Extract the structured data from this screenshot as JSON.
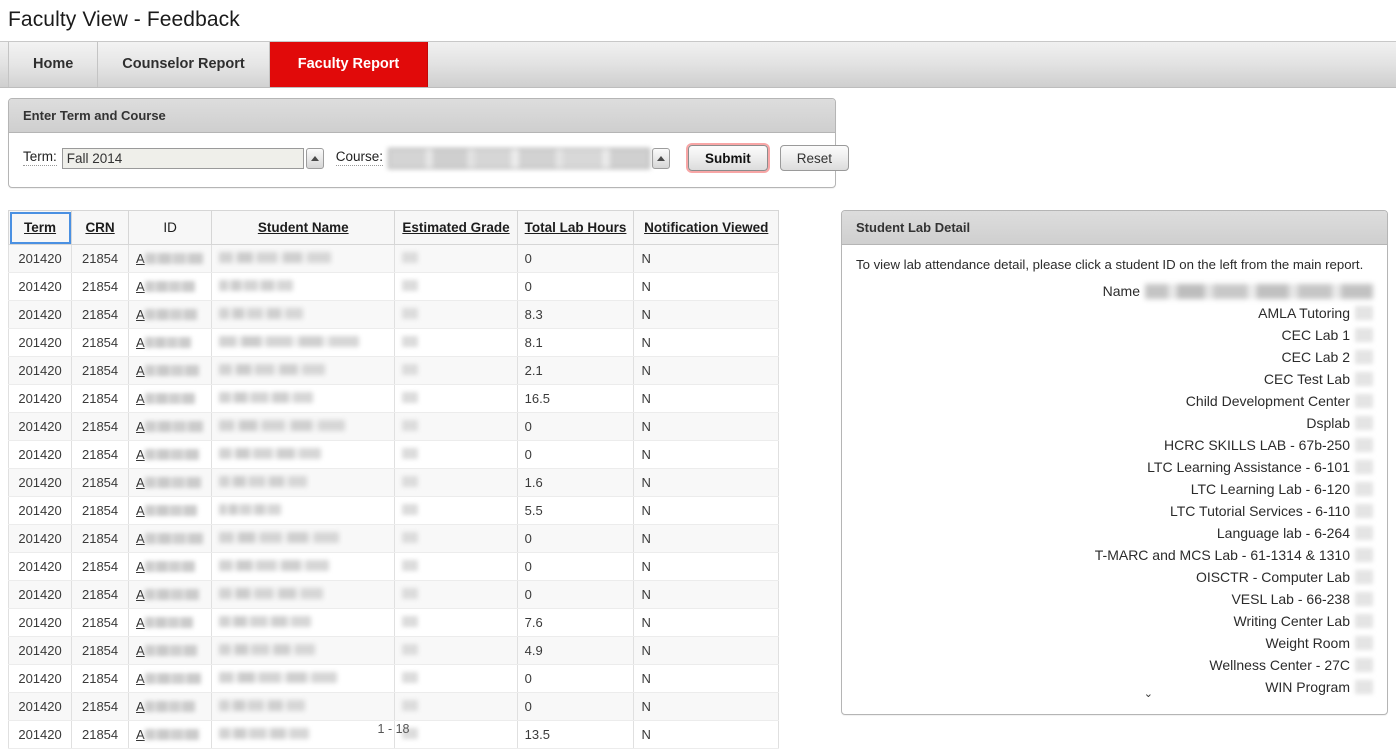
{
  "page": {
    "title": "Faculty View - Feedback"
  },
  "tabs": [
    {
      "label": "Home",
      "active": false
    },
    {
      "label": "Counselor Report",
      "active": false
    },
    {
      "label": "Faculty Report",
      "active": true
    }
  ],
  "form": {
    "legend": "Enter Term and Course",
    "term_label": "Term:",
    "term_value": "Fall 2014",
    "course_label": "Course:",
    "course_value": "",
    "submit_label": "Submit",
    "reset_label": "Reset"
  },
  "table": {
    "columns": [
      {
        "label": "Term",
        "sortable": true,
        "focused": true
      },
      {
        "label": "CRN",
        "sortable": true,
        "focused": false
      },
      {
        "label": "ID",
        "sortable": false,
        "focused": false
      },
      {
        "label": "Student Name",
        "sortable": true,
        "focused": false
      },
      {
        "label": "Estimated Grade",
        "sortable": true,
        "focused": false
      },
      {
        "label": "Total Lab Hours",
        "sortable": true,
        "focused": false
      },
      {
        "label": "Notification Viewed",
        "sortable": true,
        "focused": false
      }
    ],
    "rows": [
      {
        "term": "201420",
        "crn": "21854",
        "id_prefix": "A",
        "hours": "0",
        "notification": "N"
      },
      {
        "term": "201420",
        "crn": "21854",
        "id_prefix": "A",
        "hours": "0",
        "notification": "N"
      },
      {
        "term": "201420",
        "crn": "21854",
        "id_prefix": "A",
        "hours": "8.3",
        "notification": "N"
      },
      {
        "term": "201420",
        "crn": "21854",
        "id_prefix": "A",
        "hours": "8.1",
        "notification": "N"
      },
      {
        "term": "201420",
        "crn": "21854",
        "id_prefix": "A",
        "hours": "2.1",
        "notification": "N"
      },
      {
        "term": "201420",
        "crn": "21854",
        "id_prefix": "A",
        "hours": "16.5",
        "notification": "N"
      },
      {
        "term": "201420",
        "crn": "21854",
        "id_prefix": "A",
        "hours": "0",
        "notification": "N"
      },
      {
        "term": "201420",
        "crn": "21854",
        "id_prefix": "A",
        "hours": "0",
        "notification": "N"
      },
      {
        "term": "201420",
        "crn": "21854",
        "id_prefix": "A",
        "hours": "1.6",
        "notification": "N"
      },
      {
        "term": "201420",
        "crn": "21854",
        "id_prefix": "A",
        "hours": "5.5",
        "notification": "N"
      },
      {
        "term": "201420",
        "crn": "21854",
        "id_prefix": "A",
        "hours": "0",
        "notification": "N"
      },
      {
        "term": "201420",
        "crn": "21854",
        "id_prefix": "A",
        "hours": "0",
        "notification": "N"
      },
      {
        "term": "201420",
        "crn": "21854",
        "id_prefix": "A",
        "hours": "0",
        "notification": "N"
      },
      {
        "term": "201420",
        "crn": "21854",
        "id_prefix": "A",
        "hours": "7.6",
        "notification": "N"
      },
      {
        "term": "201420",
        "crn": "21854",
        "id_prefix": "A",
        "hours": "4.9",
        "notification": "N"
      },
      {
        "term": "201420",
        "crn": "21854",
        "id_prefix": "A",
        "hours": "0",
        "notification": "N"
      },
      {
        "term": "201420",
        "crn": "21854",
        "id_prefix": "A",
        "hours": "0",
        "notification": "N"
      },
      {
        "term": "201420",
        "crn": "21854",
        "id_prefix": "A",
        "hours": "13.5",
        "notification": "N"
      }
    ],
    "pager": "1 - 18"
  },
  "lab_detail": {
    "legend": "Student Lab Detail",
    "intro": "To view lab attendance detail, please click a student ID on the left from the main report.",
    "rows": [
      {
        "label": "Name",
        "is_name": true
      },
      {
        "label": "AMLA Tutoring",
        "is_name": false
      },
      {
        "label": "CEC Lab 1",
        "is_name": false
      },
      {
        "label": "CEC Lab 2",
        "is_name": false
      },
      {
        "label": "CEC Test Lab",
        "is_name": false
      },
      {
        "label": "Child Development Center",
        "is_name": false
      },
      {
        "label": "Dsplab",
        "is_name": false
      },
      {
        "label": "HCRC SKILLS LAB - 67b-250",
        "is_name": false
      },
      {
        "label": "LTC Learning Assistance - 6-101",
        "is_name": false
      },
      {
        "label": "LTC Learning Lab - 6-120",
        "is_name": false
      },
      {
        "label": "LTC Tutorial Services - 6-110",
        "is_name": false
      },
      {
        "label": "Language lab - 6-264",
        "is_name": false
      },
      {
        "label": "T-MARC and MCS Lab - 61-1314 & 1310",
        "is_name": false
      },
      {
        "label": "OISCTR - Computer Lab",
        "is_name": false
      },
      {
        "label": "VESL Lab - 66-238",
        "is_name": false
      },
      {
        "label": "Writing Center Lab",
        "is_name": false
      },
      {
        "label": "Weight Room",
        "is_name": false
      },
      {
        "label": "Wellness Center - 27C",
        "is_name": false
      },
      {
        "label": "WIN Program",
        "is_name": false
      }
    ],
    "scroll_indicator": "⌄"
  },
  "colors": {
    "accent_red": "#e10a0a",
    "focus_blue": "#4a90e2",
    "panel_border": "#b5b5b5"
  }
}
